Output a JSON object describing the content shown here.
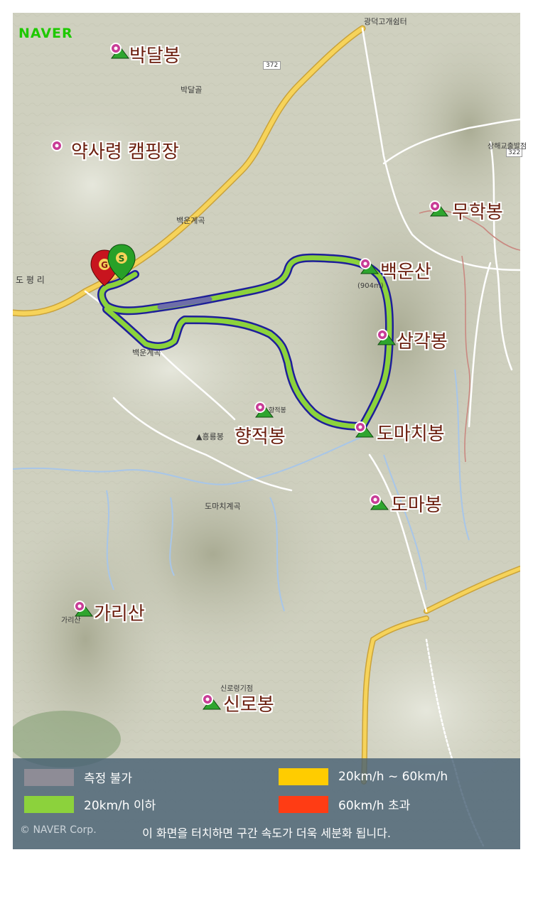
{
  "brand": {
    "logo": "NAVER",
    "copyright": "© NAVER Corp."
  },
  "peaks": [
    {
      "name": "박달봉"
    },
    {
      "name": "약사령 캠핑장"
    },
    {
      "name": "무학봉"
    },
    {
      "name": "백운산"
    },
    {
      "name": "삼각봉"
    },
    {
      "name": "향적봉"
    },
    {
      "name": "도마치봉"
    },
    {
      "name": "도마봉"
    },
    {
      "name": "가리산"
    },
    {
      "name": "신로봉"
    }
  ],
  "map_labels": {
    "gwangdeok": "광덕고개쉼터",
    "road_372": "372",
    "road_322": "322",
    "bakdalgol": "박달골",
    "sanghae": "상해교출발점",
    "baekun_valley_top": "백운계곡",
    "dopyeong": "도 평 리",
    "baekun_valley": "백운계곡",
    "baekun_elev": "(904m)",
    "hongryongbong": "▲흥룡봉",
    "domachi_valley": "도마치계곡",
    "sinro_point": "신로령기점",
    "hyangjeok_small": "향적봉",
    "gari_small": "가리산",
    "start_marker": "S",
    "goal_marker": "G"
  },
  "legend": {
    "items": [
      {
        "label": "측정 불가",
        "color": "#8e8c96"
      },
      {
        "label": "20km/h 이하",
        "color": "#8cd23c"
      },
      {
        "label": "20km/h ~ 60km/h",
        "color": "#ffcc00"
      },
      {
        "label": "60km/h 초과",
        "color": "#ff3c14"
      }
    ],
    "note": "이 화면을 터치하면 구간 속도가 더욱 세분화 됩니다."
  },
  "colors": {
    "route_outline": "#1e1e9a",
    "route_fill": "#8cd23c",
    "route_unmeasured": "#6e6ea8",
    "road_major": "#f6d35a",
    "road_minor": "#ffffff",
    "river": "#a8c6e8",
    "peak_label": "#6b1e0e",
    "logo": "#1ec800"
  }
}
